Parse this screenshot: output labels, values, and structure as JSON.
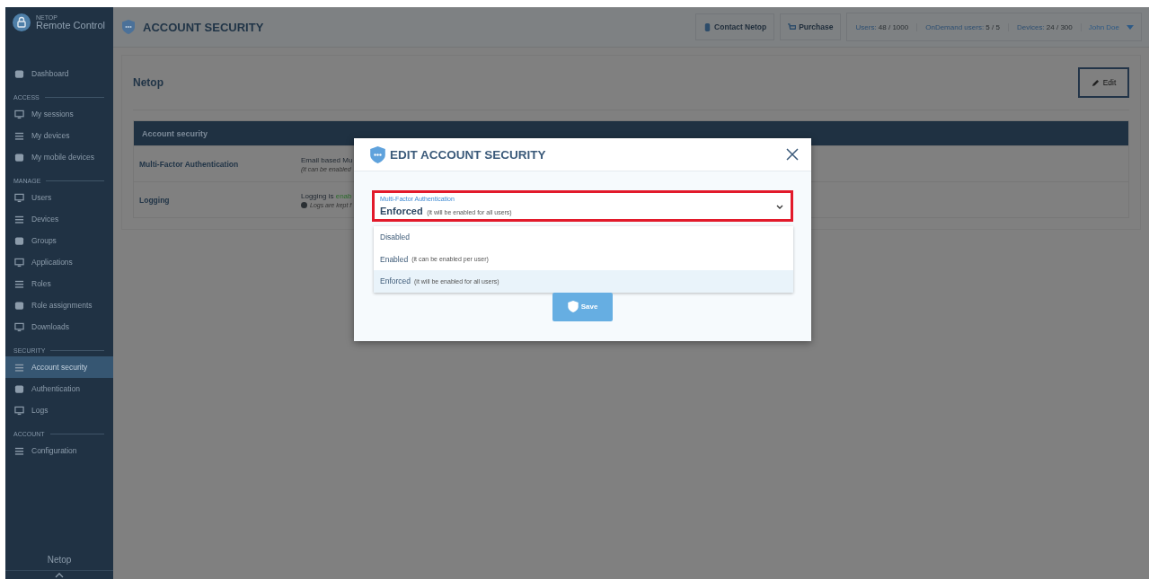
{
  "sidebar": {
    "brand_small": "NETOP",
    "brand": "Remote Control",
    "sections": [
      {
        "items": [
          {
            "label": "Dashboard",
            "selected": false
          }
        ]
      },
      {
        "label": "ACCESS",
        "items": [
          {
            "label": "My sessions",
            "selected": false
          },
          {
            "label": "My devices",
            "selected": false
          },
          {
            "label": "My mobile devices",
            "selected": false
          }
        ]
      },
      {
        "label": "MANAGE",
        "items": [
          {
            "label": "Users",
            "selected": false
          },
          {
            "label": "Devices",
            "selected": false
          },
          {
            "label": "Groups",
            "selected": false
          },
          {
            "label": "Applications",
            "selected": false
          },
          {
            "label": "Roles",
            "selected": false
          },
          {
            "label": "Role assignments",
            "selected": false
          },
          {
            "label": "Downloads",
            "selected": false
          }
        ]
      },
      {
        "label": "SECURITY",
        "items": [
          {
            "label": "Account security",
            "selected": true
          },
          {
            "label": "Authentication",
            "selected": false
          },
          {
            "label": "Logs",
            "selected": false
          }
        ]
      },
      {
        "label": "ACCOUNT",
        "items": [
          {
            "label": "Configuration",
            "selected": false
          }
        ]
      }
    ],
    "footer": "Netop"
  },
  "header": {
    "title": "ACCOUNT SECURITY",
    "buttons": [
      "Contact Netop",
      "Purchase"
    ],
    "stats": [
      {
        "label": "Users:",
        "value": "48 / 1000"
      },
      {
        "label": "OnDemand users:",
        "value": "5 / 5"
      },
      {
        "label": "Devices:",
        "value": "24 / 300"
      }
    ],
    "user": "John Doe"
  },
  "panel": {
    "title": "Netop",
    "edit_button": "Edit",
    "table_title": "Account security",
    "rows": [
      {
        "name": "Multi-Factor Authentication",
        "line_1": "Email based Mu",
        "line_2": "(it can be enabled"
      },
      {
        "name": "Logging",
        "line_1": "Logging is ",
        "line_1_status": "enab",
        "line_2": "Logs are kept f"
      }
    ]
  },
  "dialog": {
    "title": "EDIT ACCOUNT SECURITY",
    "field": {
      "label": "Multi-Factor Authentication",
      "value": "Enforced",
      "note": "(it will be enabled for all users)",
      "highlighted": true
    },
    "options": [
      {
        "label": "Disabled",
        "selected": false
      },
      {
        "label": "Enabled",
        "note": "(it can be enabled per user)",
        "selected": false
      },
      {
        "label": "Enforced",
        "note": "(it will be enabled for all users)",
        "selected": true
      }
    ],
    "save_button": "Save"
  }
}
